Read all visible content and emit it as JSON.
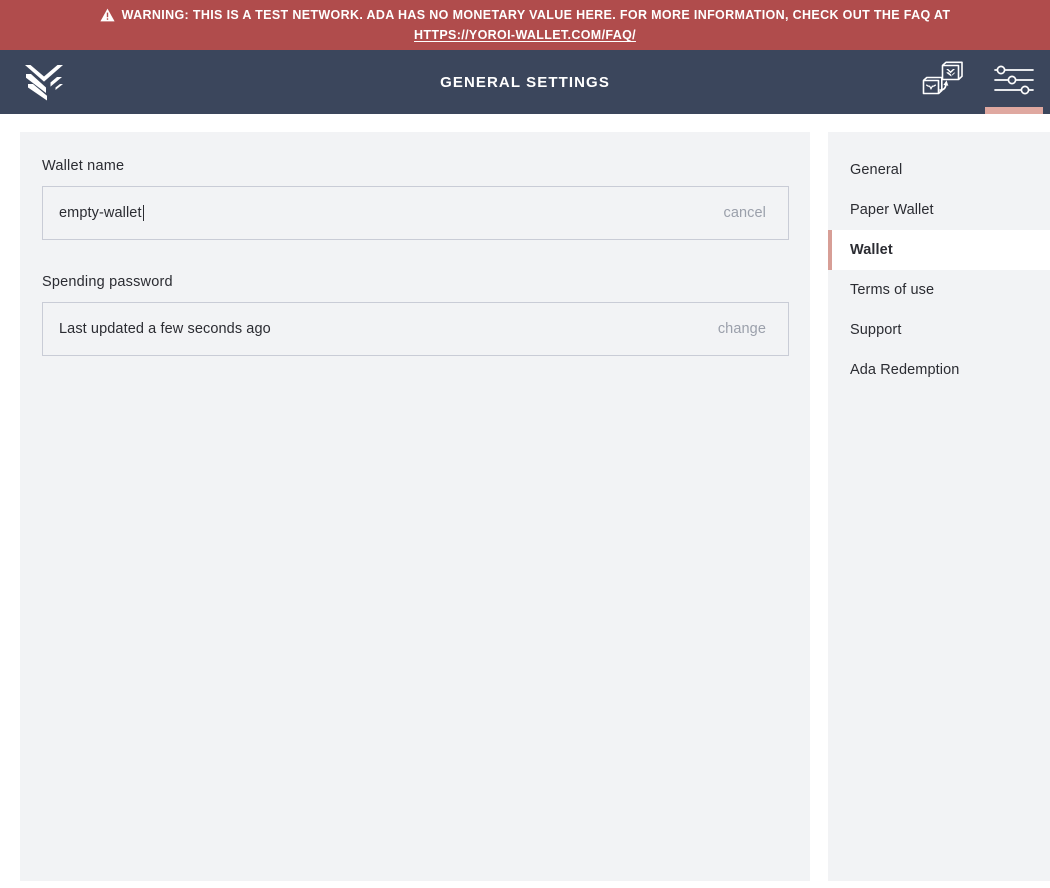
{
  "warning": {
    "icon": "warning-triangle-icon",
    "text": "WARNING: THIS IS A TEST NETWORK. ADA HAS NO MONETARY VALUE HERE. FOR MORE INFORMATION, CHECK OUT THE FAQ AT",
    "link": "HTTPS://YOROI-WALLET.COM/FAQ/",
    "background_color": "#b04c4c",
    "text_color": "#ffffff"
  },
  "topbar": {
    "logo": "yoroi-chevron-logo",
    "title": "GENERAL SETTINGS",
    "background_color": "#3b465c",
    "actions": [
      {
        "name": "wallet-switch-icon",
        "active": false
      },
      {
        "name": "settings-sliders-icon",
        "active": true
      }
    ],
    "active_indicator_color": "#dfa8a0"
  },
  "main": {
    "wallet_name": {
      "label": "Wallet name",
      "value": "empty-wallet",
      "placeholder": "Wallet name",
      "action_label": "cancel"
    },
    "spending_password": {
      "label": "Spending password",
      "status": "Last updated a few seconds ago",
      "action_label": "change"
    },
    "panel_background": "#f2f3f5"
  },
  "settings_menu": {
    "items": [
      {
        "label": "General",
        "active": false
      },
      {
        "label": "Paper Wallet",
        "active": false
      },
      {
        "label": "Wallet",
        "active": true
      },
      {
        "label": "Terms of use",
        "active": false
      },
      {
        "label": "Support",
        "active": false
      },
      {
        "label": "Ada Redemption",
        "active": false
      }
    ],
    "active_marker_color": "#d79e96",
    "panel_background": "#f2f3f5"
  }
}
